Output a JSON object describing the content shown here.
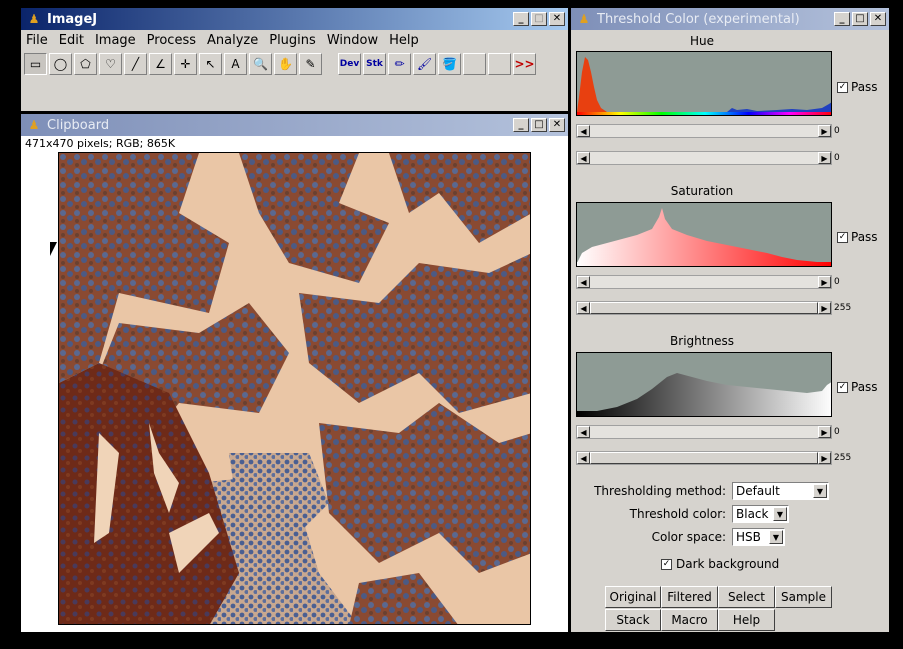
{
  "imagej": {
    "title": "ImageJ",
    "menus": [
      "File",
      "Edit",
      "Image",
      "Process",
      "Analyze",
      "Plugins",
      "Window",
      "Help"
    ],
    "tools": [
      {
        "name": "rectangle-tool",
        "glyph": "▭"
      },
      {
        "name": "oval-tool",
        "glyph": "◯"
      },
      {
        "name": "polygon-tool",
        "glyph": "⬠"
      },
      {
        "name": "freehand-tool",
        "glyph": "♡"
      },
      {
        "name": "line-tool",
        "glyph": "╱"
      },
      {
        "name": "angle-tool",
        "glyph": "∠"
      },
      {
        "name": "point-tool",
        "glyph": "✛"
      },
      {
        "name": "wand-tool",
        "glyph": "↖"
      },
      {
        "name": "text-tool",
        "glyph": "A"
      },
      {
        "name": "magnifier-tool",
        "glyph": "🔍"
      },
      {
        "name": "scroll-tool",
        "glyph": "✋"
      },
      {
        "name": "dropper-tool",
        "glyph": "✎"
      }
    ],
    "dev_label": "Dev",
    "stk_label": "Stk",
    "more_label": ">>"
  },
  "clipboard": {
    "title": "Clipboard",
    "info": "471x470 pixels; RGB; 865K"
  },
  "threshold": {
    "title": "Threshold Color (experimental)",
    "hue_label": "Hue",
    "saturation_label": "Saturation",
    "brightness_label": "Brightness",
    "pass_label": "Pass",
    "hue_min": "0",
    "hue_max": "0",
    "sat_min": "0",
    "sat_max": "255",
    "bri_min": "0",
    "bri_max": "255",
    "method_label": "Thresholding method:",
    "method_value": "Default",
    "color_label": "Threshold color:",
    "color_value": "Black",
    "space_label": "Color space:",
    "space_value": "HSB",
    "dark_bg_label": "Dark background",
    "buttons_row1": [
      "Original",
      "Filtered",
      "Select",
      "Sample"
    ],
    "buttons_row2": [
      "Stack",
      "Macro",
      "Help"
    ]
  }
}
